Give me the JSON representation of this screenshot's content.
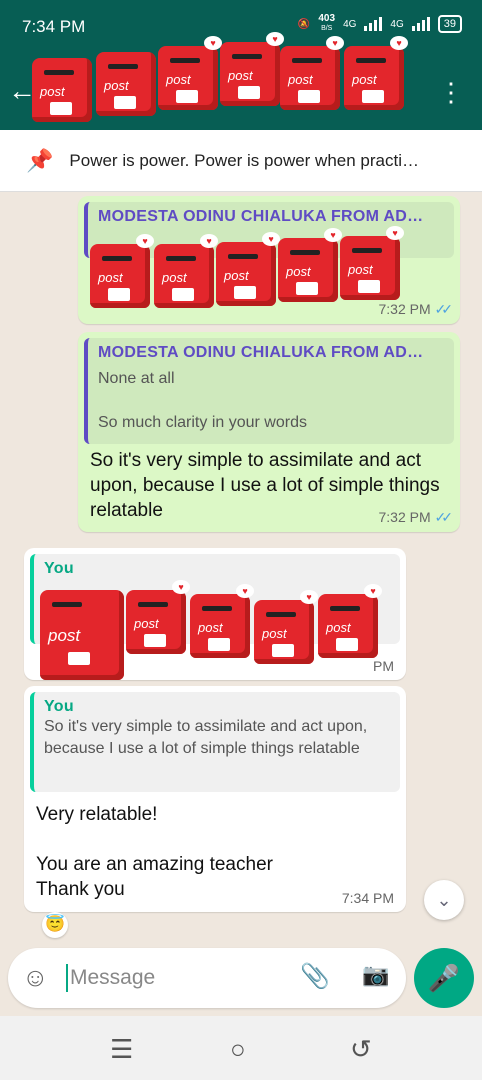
{
  "status_bar": {
    "time": "7:34 PM",
    "speed_value": "403",
    "speed_unit": "B/S",
    "network_1": "4G",
    "network_2": "4G",
    "battery": "39"
  },
  "pinned": {
    "text": "Power is power. Power is power when practi…"
  },
  "messages": [
    {
      "direction": "outgoing",
      "quote_author": "MODESTA ODINU CHIALUKA FROM AD…",
      "time": "7:32 PM"
    },
    {
      "direction": "outgoing",
      "quote_author": "MODESTA ODINU CHIALUKA FROM AD…",
      "quote_line1": "None at all",
      "quote_line2": "So much clarity in your words",
      "text": "So it's very simple to assimilate and act upon, because I use a lot of simple things relatable",
      "time": "7:32 PM"
    },
    {
      "direction": "incoming",
      "quote_author": "You",
      "time": "PM"
    },
    {
      "direction": "incoming",
      "quote_author": "You",
      "quote_text": "So it's very simple to assimilate and act upon, because I use a lot of simple things relatable",
      "line1": "Very relatable!",
      "line2": "You are an amazing teacher",
      "line3": "Thank you",
      "time": "7:34 PM",
      "reaction": "😇"
    }
  ],
  "sticker_label": "post",
  "input": {
    "placeholder": "Message"
  },
  "icons": {
    "back": "back-arrow-icon",
    "menu": "more-vert-icon",
    "pin": "pin-icon",
    "emoji": "emoji-icon",
    "attach": "paperclip-icon",
    "camera": "camera-icon",
    "mic": "mic-icon",
    "scroll": "double-chevron-down-icon"
  },
  "colors": {
    "header": "#075e54",
    "outgoing_bubble": "#dcf8c6",
    "accent": "#00a884",
    "read_ticks": "#4fa3e0"
  }
}
